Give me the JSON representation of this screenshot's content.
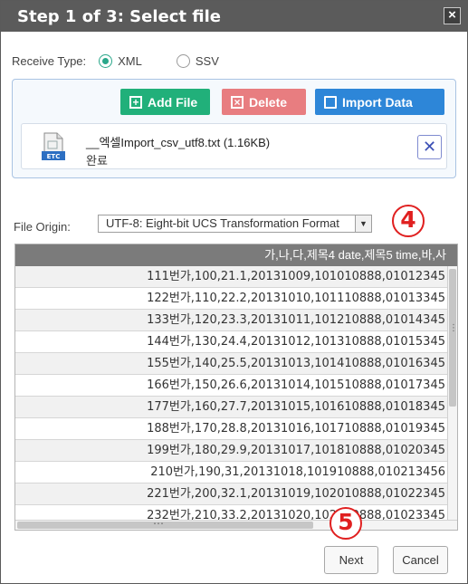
{
  "dialog": {
    "title": "Step 1 of 3: Select file",
    "close_label": "×"
  },
  "receive": {
    "label": "Receive Type:",
    "options": [
      "XML",
      "SSV"
    ],
    "selected": "XML"
  },
  "toolbar": {
    "add_label": "Add File",
    "add_icon": "plus-square-icon",
    "delete_label": "Delete",
    "delete_icon": "x-square-icon",
    "import_label": "Import Data",
    "import_icon": "save-icon",
    "add_color": "#21b07a",
    "delete_color": "#e87d80",
    "import_color": "#2d86d8"
  },
  "file": {
    "icon_text": "ETC",
    "name": "__엑셀Import_csv_utf8.txt (1.16KB)",
    "status": "완료",
    "remove_label": "✕"
  },
  "origin": {
    "label": "File Origin:",
    "value": "UTF-8: Eight-bit UCS Transformation Format"
  },
  "grid": {
    "header": "가,나,다,제목4 date,제목5 time,바,사",
    "rows": [
      "111번가,100,21.1,20131009,101010888,01012345",
      "122번가,110,22.2,20131010,101110888,01013345",
      "133번가,120,23.3,20131011,101210888,01014345",
      "144번가,130,24.4,20131012,101310888,01015345",
      "155번가,140,25.5,20131013,101410888,01016345",
      "166번가,150,26.6,20131014,101510888,01017345",
      "177번가,160,27.7,20131015,101610888,01018345",
      "188번가,170,28.8,20131016,101710888,01019345",
      "199번가,180,29.9,20131017,101810888,01020345",
      "210번가,190,31,20131018,101910888,010213456",
      "221번가,200,32.1,20131019,102010888,01022345",
      "232번가,210,33.2,20131020,102110888,01023345"
    ]
  },
  "markers": {
    "step4": "4",
    "step5": "5",
    "color": "#e02020"
  },
  "footer": {
    "next_label": "Next",
    "cancel_label": "Cancel"
  }
}
